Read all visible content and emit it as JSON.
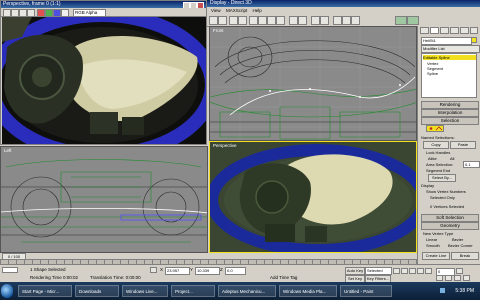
{
  "render_window": {
    "title": "Perspective, frame 0 (1:1)",
    "channel": "RGB Alpha"
  },
  "main_window": {
    "title": "Display - Direct 3D",
    "menu": [
      "View",
      "MAXScript",
      "Help"
    ]
  },
  "viewports": {
    "front": "Front",
    "left": "Left",
    "perspective": "Perspective"
  },
  "command_panel": {
    "object_name": "HeliSt1",
    "modifier_list": "Modifier List",
    "stack": [
      "Editable Spline",
      "Vertex",
      "Segment",
      "Spline"
    ],
    "rollouts": {
      "rendering": "Rendering",
      "interpolation": "Interpolation",
      "selection": "Selection",
      "soft_selection": "Soft Selection",
      "geometry": "Geometry"
    },
    "named_selections": "Named Selections:",
    "copy": "Copy",
    "paste": "Paste",
    "lock_handles": "Lock Handles",
    "alike": "Alike",
    "all": "All",
    "area_selection": "Area Selection:",
    "area_value": "0.1",
    "segment_end": "Segment End",
    "select_by": "Select By...",
    "display": "Display",
    "show_vertex_numbers": "Show Vertex Numbers",
    "selected_only": "Selected Only",
    "vertices_selected": "0 Vertices Selected",
    "new_vertex_type": "New Vertex Type",
    "linear": "Linear",
    "bezier": "Bezier",
    "smooth": "Smooth",
    "bezier_corner": "Bezier Corner",
    "create_line": "Create Line",
    "break": "Break"
  },
  "timeline": {
    "frame": "0 / 100"
  },
  "status": {
    "selected": "1 Shape Selected",
    "render_time": "Rendering Time 0:00:02",
    "translation_time": "Translation Time: 0:00:00",
    "x": "23.957",
    "y": "10.339",
    "z": "0.0",
    "add_time_tag": "Add Time Tag",
    "auto_key": "Auto Key",
    "selected_dropdown": "Selected",
    "set_key": "Set Key",
    "key_filters": "Key Filters...",
    "frame_field": "0"
  },
  "taskbar": {
    "items": [
      "Start Page - Micr...",
      "Downloads",
      "Windows Live...",
      "Project...",
      "Adeptus Mechanicu...",
      "Windows Media Pla...",
      "Untitled - Paint"
    ],
    "clock": "5:38 PM"
  },
  "colors": {
    "accent": "#f0e020",
    "title_bar": "#0a246a",
    "wireframe_green": "#1e8c2a",
    "ring_blue": "#1a2a9a",
    "cream_mesh": "#ddd9b0"
  }
}
